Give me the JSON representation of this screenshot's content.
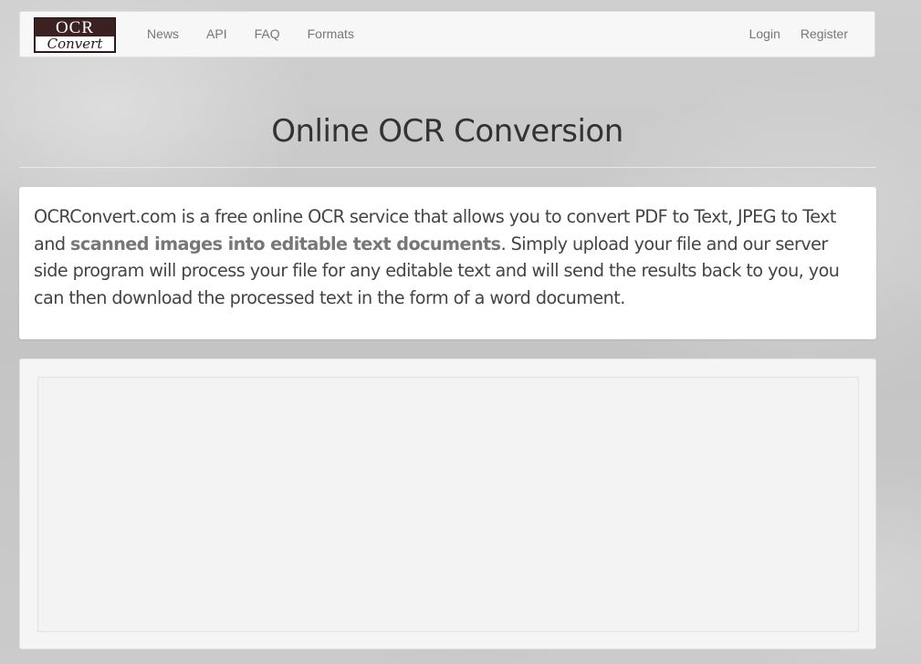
{
  "header": {
    "logo": {
      "line1": "OCR",
      "line2": "Convert"
    },
    "nav_left": [
      {
        "label": "News"
      },
      {
        "label": "API"
      },
      {
        "label": "FAQ"
      },
      {
        "label": "Formats"
      }
    ],
    "nav_right": [
      {
        "label": "Login"
      },
      {
        "label": "Register"
      }
    ]
  },
  "main": {
    "title": "Online OCR Conversion",
    "intro": {
      "text_before": "OCRConvert.com is a free online OCR service that allows you to convert PDF to Text, JPEG to Text and ",
      "text_bold": "scanned images into editable text documents",
      "text_after": ". Simply upload your file and our server side program will process your file for any editable text and will send the results back to you, you can then download the processed text in the form of a word document."
    }
  },
  "colors": {
    "navbar_bg": "#f7f7f7",
    "nav_link": "#777777",
    "logo_bg": "#3b2220",
    "panel_bg": "#ffffff",
    "upload_bg": "#f5f5f5"
  }
}
